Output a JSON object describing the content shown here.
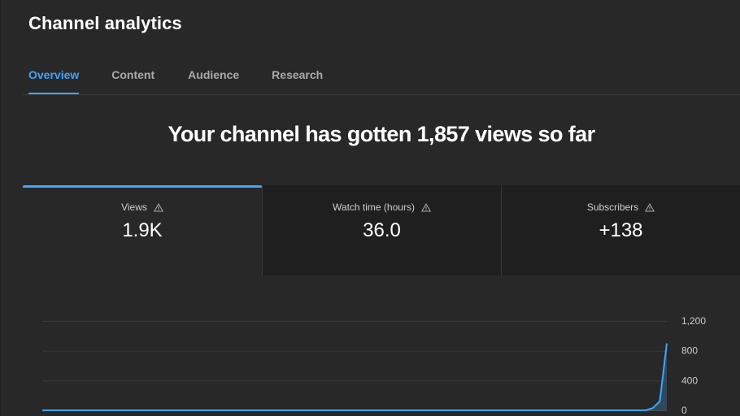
{
  "header": {
    "title": "Channel analytics"
  },
  "tabs": [
    {
      "label": "Overview",
      "active": true
    },
    {
      "label": "Content",
      "active": false
    },
    {
      "label": "Audience",
      "active": false
    },
    {
      "label": "Research",
      "active": false
    }
  ],
  "headline": "Your channel has gotten 1,857 views so far",
  "metrics": [
    {
      "label": "Views",
      "value": "1.9K",
      "icon": "warning-icon",
      "active": true
    },
    {
      "label": "Watch time (hours)",
      "value": "36.0",
      "icon": "warning-icon",
      "active": false
    },
    {
      "label": "Subscribers",
      "value": "+138",
      "icon": "warning-icon",
      "active": false
    }
  ],
  "colors": {
    "accent": "#3ea6ff",
    "background": "#282828",
    "card_background": "#1f1f1f",
    "gridline": "#3a3a3a"
  },
  "chart_data": {
    "type": "line",
    "series": [
      {
        "values": [
          0,
          0,
          0,
          0,
          0,
          0,
          0,
          0,
          0,
          0,
          0,
          0,
          0,
          0,
          0,
          0,
          0,
          0,
          0,
          0,
          0,
          0,
          0,
          0,
          0,
          0,
          0,
          0,
          0,
          0,
          0,
          0,
          0,
          0,
          0,
          0,
          0,
          0,
          0,
          0,
          0,
          0,
          0,
          0,
          0,
          0,
          0,
          0,
          0,
          0,
          0,
          0,
          0,
          0,
          0,
          0,
          0,
          0,
          0,
          0,
          0,
          0,
          0,
          0,
          0,
          0,
          0,
          0,
          0,
          0,
          0,
          0,
          0,
          0,
          0,
          0,
          0,
          0,
          0,
          0,
          0,
          0,
          0,
          0,
          0,
          0,
          0,
          30,
          120,
          900
        ]
      }
    ],
    "yticks": [
      "1,200",
      "800",
      "400",
      "0"
    ],
    "ytick_values": [
      1200,
      800,
      400,
      0
    ],
    "ylim": [
      0,
      1200
    ],
    "grid": true
  }
}
